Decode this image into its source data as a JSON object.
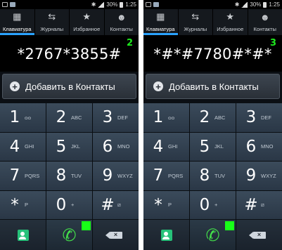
{
  "screens": [
    {
      "time": "1:25",
      "battery": "30%",
      "tabs": [
        {
          "label": "Клавиатура",
          "icon": "dialpad-icon"
        },
        {
          "label": "Журналы",
          "icon": "call-log-icon"
        },
        {
          "label": "Избранное",
          "icon": "star-icon"
        },
        {
          "label": "Контакты",
          "icon": "person-icon"
        }
      ],
      "dialed_code": "*2767*3855#",
      "step_number": "2",
      "add_to_contacts": "Добавить в Контакты",
      "keys": [
        {
          "digit": "1",
          "letters": "ᴑᴑ"
        },
        {
          "digit": "2",
          "letters": "ABC"
        },
        {
          "digit": "3",
          "letters": "DEF"
        },
        {
          "digit": "4",
          "letters": "GHI"
        },
        {
          "digit": "5",
          "letters": "JKL"
        },
        {
          "digit": "6",
          "letters": "MNO"
        },
        {
          "digit": "7",
          "letters": "PQRS"
        },
        {
          "digit": "8",
          "letters": "TUV"
        },
        {
          "digit": "9",
          "letters": "WXYZ"
        },
        {
          "digit": "*",
          "letters": "P"
        },
        {
          "digit": "0",
          "letters": "+"
        },
        {
          "digit": "#",
          "letters": "⧄"
        }
      ]
    },
    {
      "time": "1:25",
      "battery": "30%",
      "tabs": [
        {
          "label": "Клавиатура",
          "icon": "dialpad-icon"
        },
        {
          "label": "Журналы",
          "icon": "call-log-icon"
        },
        {
          "label": "Избранное",
          "icon": "star-icon"
        },
        {
          "label": "Контакты",
          "icon": "person-icon"
        }
      ],
      "dialed_code": "*#*#7780#*#*",
      "step_number": "3",
      "add_to_contacts": "Добавить в Контакты",
      "keys": [
        {
          "digit": "1",
          "letters": "ᴑᴑ"
        },
        {
          "digit": "2",
          "letters": "ABC"
        },
        {
          "digit": "3",
          "letters": "DEF"
        },
        {
          "digit": "4",
          "letters": "GHI"
        },
        {
          "digit": "5",
          "letters": "JKL"
        },
        {
          "digit": "6",
          "letters": "MNO"
        },
        {
          "digit": "7",
          "letters": "PQRS"
        },
        {
          "digit": "8",
          "letters": "TUV"
        },
        {
          "digit": "9",
          "letters": "WXYZ"
        },
        {
          "digit": "*",
          "letters": "P"
        },
        {
          "digit": "0",
          "letters": "+"
        },
        {
          "digit": "#",
          "letters": "⧄"
        }
      ]
    }
  ],
  "colors": {
    "active_tab_underline": "#2aa2ff",
    "step_number": "#1eea1e",
    "call_icon": "#43e04a",
    "green_marker": "#18ff18",
    "key_top": "#3b4b5b",
    "key_bottom": "#2a3746"
  }
}
